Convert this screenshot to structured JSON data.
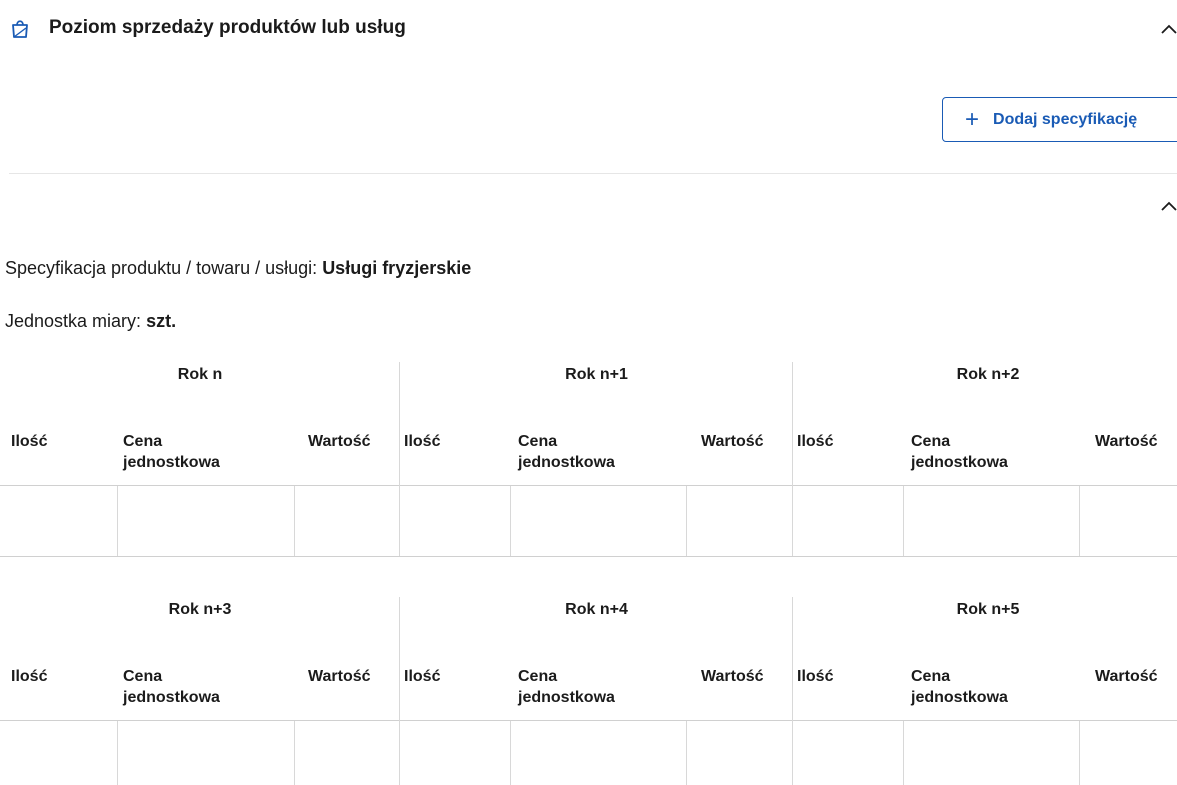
{
  "section": {
    "title": "Poziom sprzedaży produktów lub usług",
    "icon": "shopping-bag-icon"
  },
  "add_button": {
    "label": "Dodaj specyfikację",
    "icon": "plus-icon"
  },
  "spec": {
    "label": "Specyfikacja produktu / towaru / usługi:",
    "value": "Usługi fryzjerskie"
  },
  "unit": {
    "label": "Jednostka miary:",
    "value": "szt."
  },
  "columns": {
    "qty": "Ilość",
    "price_line1": "Cena",
    "price_line2": "jednostkowa",
    "value": "Wartość"
  },
  "tables": [
    {
      "years": [
        "Rok n",
        "Rok n+1",
        "Rok n+2"
      ]
    },
    {
      "years": [
        "Rok n+3",
        "Rok n+4",
        "Rok n+5"
      ]
    }
  ],
  "colors": {
    "accent": "#1a5bb5",
    "text": "#1b1b1b",
    "border": "#d0d0d0"
  }
}
